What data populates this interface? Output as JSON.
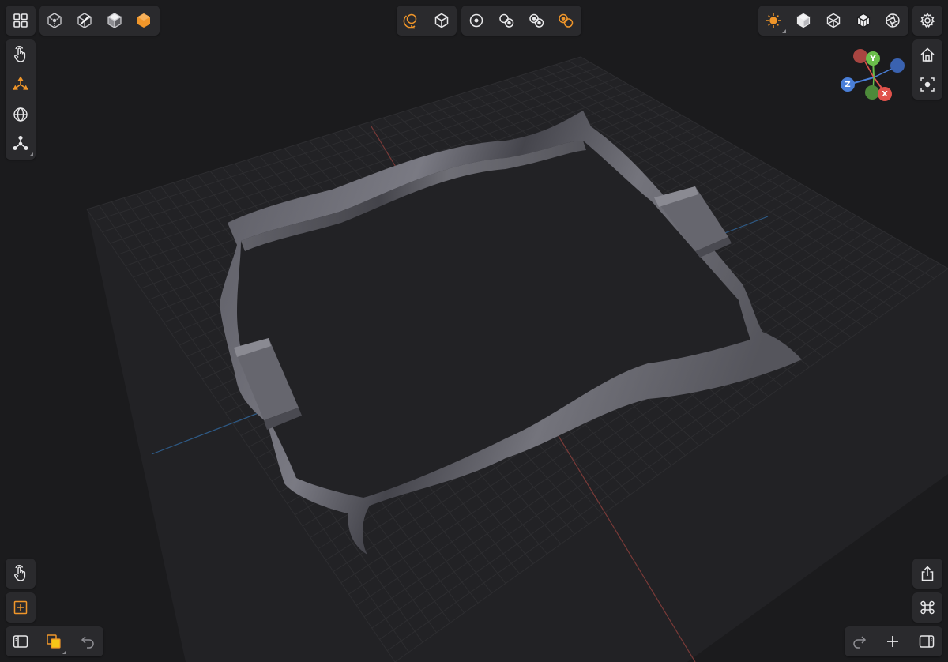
{
  "colors": {
    "background": "#1b1b1d",
    "panel": "#2a2a2d",
    "icon": "#e8e8ea",
    "accent": "#f0962a",
    "axis_x": "#e0524b",
    "axis_y": "#6abf4b",
    "axis_z": "#4a7fd8",
    "grid_line": "#2d2d30",
    "model": "#66666e"
  },
  "top_left_menu": {
    "icon": "grid-menu-icon"
  },
  "display_modes": {
    "items": [
      "wireframe-mode-icon",
      "hidden-line-mode-icon",
      "shaded-mode-icon",
      "rendered-mode-icon"
    ],
    "active": "rendered-mode-icon"
  },
  "center_tools_a": {
    "items": [
      "globe-stand-icon",
      "cube-icon"
    ]
  },
  "center_tools_b": {
    "items": [
      "single-circle-icon",
      "two-circles-icon",
      "three-circles-icon",
      "orange-circles-icon"
    ]
  },
  "view_tools": {
    "items": [
      "sun-lighting-icon",
      "solid-cube-icon",
      "wire-cube-icon",
      "cube-edges-icon",
      "camera-aperture-icon"
    ]
  },
  "left_tools": {
    "items": [
      "touch-hand-icon",
      "move-axes-icon",
      "rotate-globe-icon",
      "pivot-icon"
    ],
    "active": "move-axes-icon"
  },
  "right_tools": {
    "items": [
      "settings-gear-icon",
      "home-icon",
      "focus-frame-icon"
    ]
  },
  "gizmo": {
    "x_label": "X",
    "y_label": "Y",
    "z_label": "Z"
  },
  "bottom_left": {
    "items": [
      "touch-hand-icon",
      "snap-target-icon",
      "sidebar-toggle-icon",
      "layers-icon",
      "undo-icon"
    ]
  },
  "bottom_right": {
    "items": [
      "share-icon",
      "command-icon",
      "redo-icon",
      "add-icon",
      "right-panel-icon"
    ]
  }
}
